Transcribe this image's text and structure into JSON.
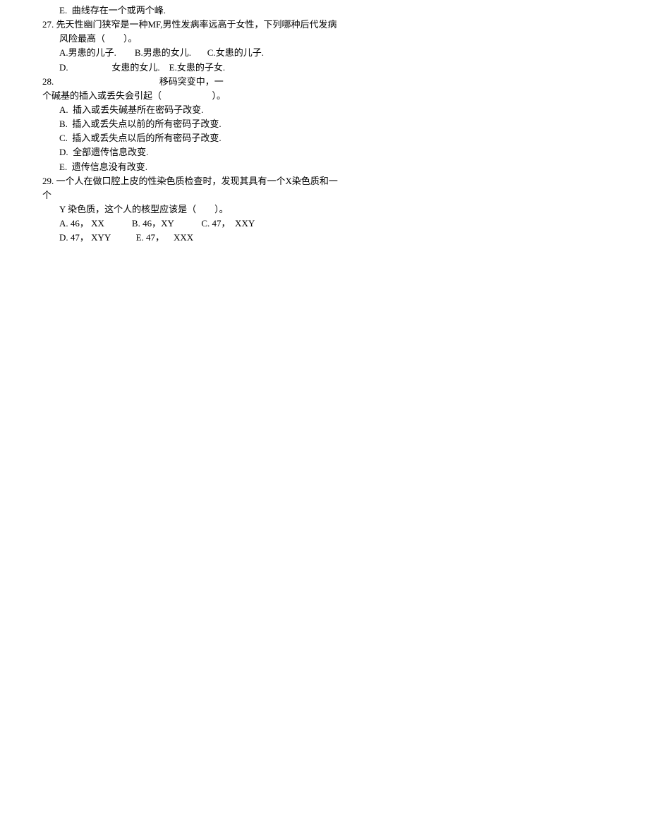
{
  "lines": {
    "l1": "E.  曲线存在一个或两个峰.",
    "l2": "27. 先天性幽门狭窄是一种MF,男性发病率远高于女性，下列哪种后代发病",
    "l3": "风险最高（        ）。",
    "l4": "A.男患的儿子.        B.男患的女儿.       C.女患的儿子.",
    "l5": "D.                   女患的女儿.    E.女患的子女.",
    "l6": "28.                                              移码突变中，一",
    "l7": "个碱基的插入或丢失会引起（                      ）。",
    "l8": "A.  插入或丢失碱基所在密码子改变.",
    "l9": "B.  插入或丢失点以前的所有密码子改变.",
    "l10": "C.  插入或丢失点以后的所有密码子改变.",
    "l11": "D.  全部遗传信息改变.",
    "l12": "E.  遗传信息没有改变.",
    "l13": "29. 一个人在做口腔上皮的性染色质检查时，发现其具有一个X染色质和一",
    "l14": "个",
    "l15": "Y 染色质，这个人的核型应该是（        ）。",
    "l16": "A. 46， XX            B. 46，XY            C. 47，  XXY",
    "l17": "D. 47， XYY           E. 47，    XXX"
  }
}
